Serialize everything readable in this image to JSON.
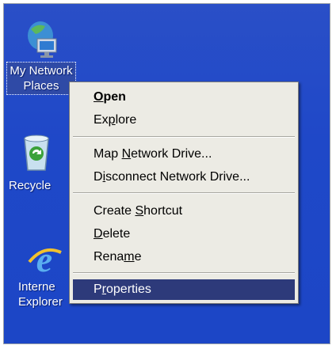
{
  "desktop": {
    "icons": [
      {
        "label_line1": "My Network",
        "label_line2": "Places",
        "icon": "network-places-icon"
      },
      {
        "label_line1": "Recycle",
        "label_line2": "",
        "icon": "recycle-bin-icon"
      },
      {
        "label_line1": "Interne",
        "label_line2": "Explorer",
        "icon": "internet-explorer-icon"
      }
    ]
  },
  "context_menu": {
    "items": [
      {
        "pre": "",
        "key": "O",
        "post": "pen",
        "bold": true
      },
      {
        "pre": "Ex",
        "key": "p",
        "post": "lore"
      },
      {
        "pre": "Map ",
        "key": "N",
        "post": "etwork Drive..."
      },
      {
        "pre": "D",
        "key": "i",
        "post": "sconnect Network Drive..."
      },
      {
        "pre": "Create ",
        "key": "S",
        "post": "hortcut"
      },
      {
        "pre": "",
        "key": "D",
        "post": "elete"
      },
      {
        "pre": "Rena",
        "key": "m",
        "post": "e"
      },
      {
        "pre": "P",
        "key": "r",
        "post": "operties",
        "selected": true
      }
    ]
  },
  "colors": {
    "desktop": "#1f48c8",
    "menu_bg": "#ecebe4",
    "highlight": "#2d3a7a"
  }
}
